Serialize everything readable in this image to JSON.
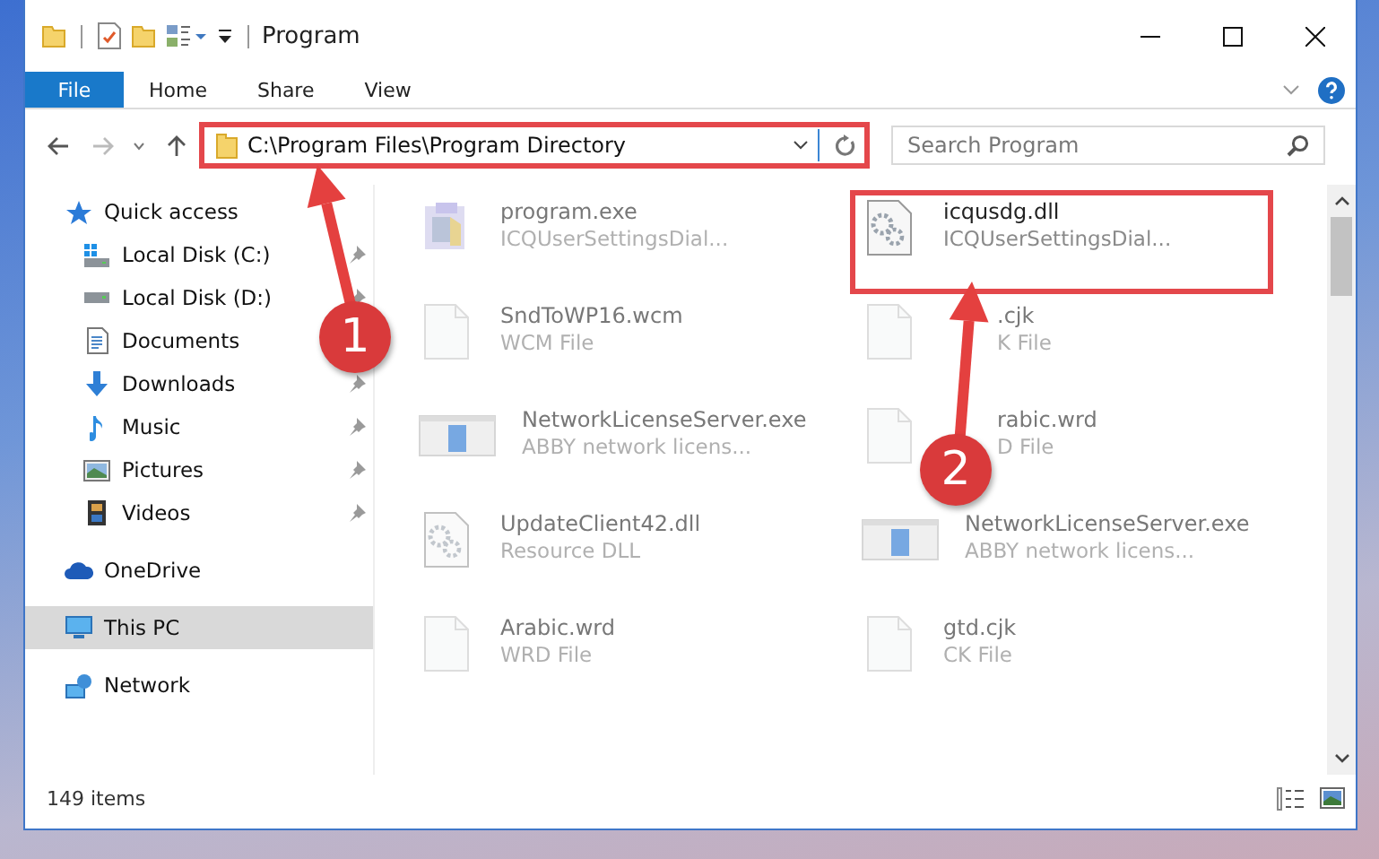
{
  "window": {
    "title": "Program"
  },
  "ribbon_tabs": [
    {
      "label": "File",
      "kind": "file",
      "selected": false
    },
    {
      "label": "Home",
      "kind": "tab",
      "selected": false
    },
    {
      "label": "Share",
      "kind": "tab",
      "selected": false
    },
    {
      "label": "View",
      "kind": "tab",
      "selected": false
    }
  ],
  "address": {
    "path": "C:\\Program Files\\Program Directory",
    "highlighted": true
  },
  "search": {
    "placeholder": "Search Program"
  },
  "nav": [
    {
      "label": "Quick access",
      "kind": "star",
      "selected": false,
      "children": [
        {
          "label": "Local Disk (C:)",
          "kind": "drive-c",
          "pinned": true,
          "selected": false
        },
        {
          "label": "Local Disk (D:)",
          "kind": "drive",
          "pinned": true,
          "selected": false
        },
        {
          "label": "Documents",
          "kind": "documents",
          "pinned": false,
          "selected": false
        },
        {
          "label": "Downloads",
          "kind": "downloads",
          "pinned": true,
          "selected": false
        },
        {
          "label": "Music",
          "kind": "music",
          "pinned": true,
          "selected": false
        },
        {
          "label": "Pictures",
          "kind": "pictures",
          "pinned": true,
          "selected": false
        },
        {
          "label": "Videos",
          "kind": "videos",
          "pinned": true,
          "selected": false
        }
      ]
    },
    {
      "label": "OneDrive",
      "kind": "cloud",
      "selected": false
    },
    {
      "label": "This PC",
      "kind": "pc",
      "selected": true
    },
    {
      "label": "Network",
      "kind": "network",
      "selected": false
    }
  ],
  "files": [
    {
      "name": "program.exe",
      "description": "ICQUserSettingsDial...",
      "kind": "installer",
      "blurred": true,
      "highlighted": false
    },
    {
      "name": "icqusdg.dll",
      "description": "ICQUserSettingsDial...",
      "kind": "dll",
      "blurred": false,
      "highlighted": true
    },
    {
      "name": "SndToWP16.wcm",
      "description": "WCM File",
      "kind": "blank",
      "blurred": true,
      "highlighted": false
    },
    {
      "name": ".cjk",
      "description": "K File",
      "kind": "blank",
      "blurred": true,
      "highlighted": false
    },
    {
      "name": "NetworkLicenseServer.exe",
      "description": "ABBY network licens...",
      "kind": "app",
      "blurred": true,
      "highlighted": false
    },
    {
      "name": "rabic.wrd",
      "description": "D File",
      "kind": "blank",
      "blurred": true,
      "highlighted": false
    },
    {
      "name": "UpdateClient42.dll",
      "description": "Resource DLL",
      "kind": "dll",
      "blurred": true,
      "highlighted": false
    },
    {
      "name": "NetworkLicenseServer.exe",
      "description": "ABBY network licens...",
      "kind": "app",
      "blurred": true,
      "highlighted": false
    },
    {
      "name": "Arabic.wrd",
      "description": "WRD File",
      "kind": "blank",
      "blurred": true,
      "highlighted": false
    },
    {
      "name": "gtd.cjk",
      "description": "CK File",
      "kind": "blank",
      "blurred": true,
      "highlighted": false
    }
  ],
  "status_bar": {
    "count": "149 items"
  },
  "annotations": [
    {
      "label": "1"
    },
    {
      "label": "2"
    }
  ]
}
